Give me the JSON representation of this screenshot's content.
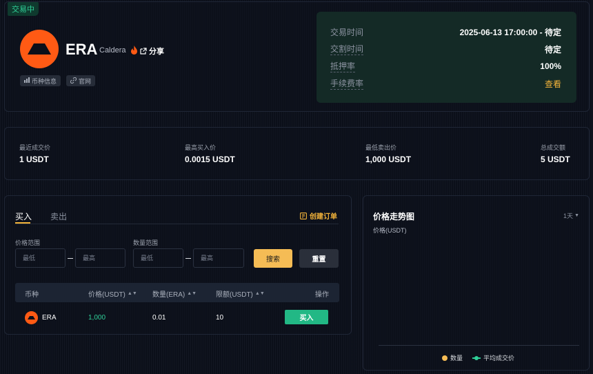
{
  "status_tag": "交易中",
  "coin": {
    "symbol": "ERA",
    "name": "Caldera",
    "share_label": "分享",
    "links": [
      {
        "label": "币种信息",
        "icon": "chart-icon"
      },
      {
        "label": "官网",
        "icon": "link-icon"
      }
    ],
    "brand_color": "#ff5a14"
  },
  "info": [
    {
      "key": "交易时间",
      "value": "2025-06-13 17:00:00 - 待定"
    },
    {
      "key": "交割时间",
      "value": "待定"
    },
    {
      "key": "抵押率",
      "value": "100%"
    },
    {
      "key": "手续费率",
      "value": "查看"
    }
  ],
  "stats": [
    {
      "label": "最近成交价",
      "value": "1 USDT"
    },
    {
      "label": "最高买入价",
      "value": "0.0015 USDT"
    },
    {
      "label": "最低卖出价",
      "value": "1,000 USDT"
    },
    {
      "label": "总成交额",
      "value": "5 USDT"
    }
  ],
  "orders": {
    "tabs": [
      "买入",
      "卖出"
    ],
    "active_tab": "买入",
    "create_order": "创建订单",
    "price_range_label": "价格范围",
    "quantity_range_label": "数量范围",
    "min_placeholder": "最低",
    "max_placeholder": "最高",
    "search_label": "搜索",
    "reset_label": "重置",
    "columns": [
      "币种",
      "价格(USDT)",
      "数量(ERA)",
      "限额(USDT)",
      "操作"
    ],
    "rows": [
      {
        "coin": "ERA",
        "price": "1,000",
        "quantity": "0.01",
        "limit": "10",
        "action": "买入"
      }
    ]
  },
  "chart_data": {
    "type": "line",
    "title": "价格走势图",
    "range_selector": "1天",
    "ylabel": "价格(USDT)",
    "series": [
      {
        "name": "数量",
        "values": []
      },
      {
        "name": "平均成交价",
        "values": []
      }
    ],
    "legend_position": "bottom",
    "colors": {
      "quantity": "#f5bc55",
      "avg_price": "#2fcf98"
    }
  },
  "colors": {
    "accent": "#f4b43a",
    "up": "#2fcf98",
    "buy_button": "#22b885"
  }
}
